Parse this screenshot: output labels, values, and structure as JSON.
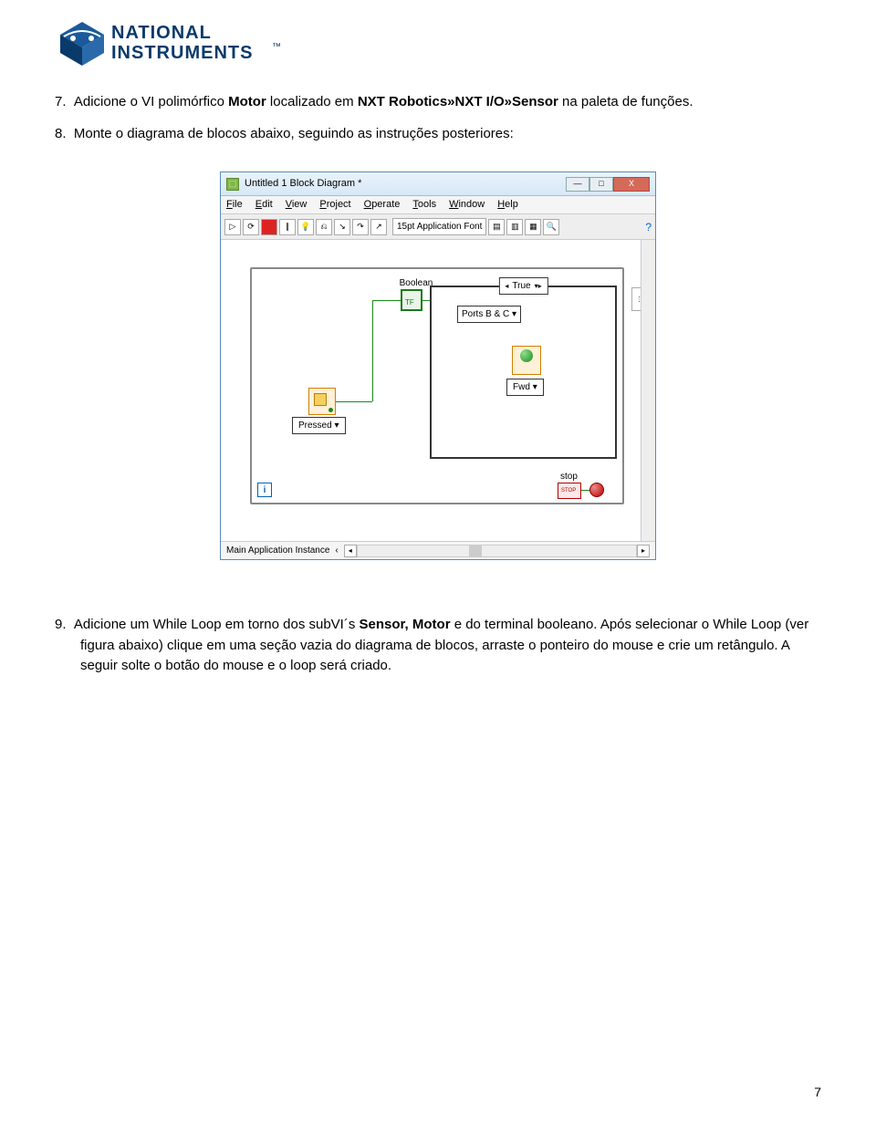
{
  "logo": {
    "line1": "NATIONAL",
    "line2": "INSTRUMENTS",
    "tm": "™"
  },
  "step7": {
    "num": "7.",
    "t1": "Adicione o VI polimórfico ",
    "b1": "Motor",
    "t2": " localizado em ",
    "b2": "NXT Robotics»NXT I/O»Sensor",
    "t3": " na paleta de funções."
  },
  "step8": {
    "num": "8.",
    "t1": "Monte o diagrama de blocos abaixo, seguindo as instruções posteriores:"
  },
  "step9": {
    "num": "9.",
    "t1": "Adicione um While Loop em torno dos subVI´s ",
    "b1": "Sensor, Motor",
    "t2": " e do terminal booleano. Após selecionar o While Loop (ver figura abaixo) clique em uma seção vazia do diagrama de blocos, arraste o ponteiro do mouse e crie um retângulo. A seguir solte o botão do mouse e o loop será criado."
  },
  "win": {
    "title": "Untitled 1 Block Diagram *",
    "menu": {
      "file": "File",
      "edit": "Edit",
      "view": "View",
      "project": "Project",
      "operate": "Operate",
      "tools": "Tools",
      "window": "Window",
      "help": "Help"
    },
    "font": "15pt Application Font",
    "help_icon": "?"
  },
  "diagram": {
    "boolean": "Boolean",
    "case_true": "True",
    "ports": "Ports B & C",
    "fwd": "Fwd",
    "pressed": "Pressed",
    "stop": "stop",
    "loop_i": "i"
  },
  "statusbar": {
    "text": "Main Application Instance"
  },
  "winbtns": {
    "min": "—",
    "max": "□",
    "close": "X"
  },
  "page_num": "7"
}
